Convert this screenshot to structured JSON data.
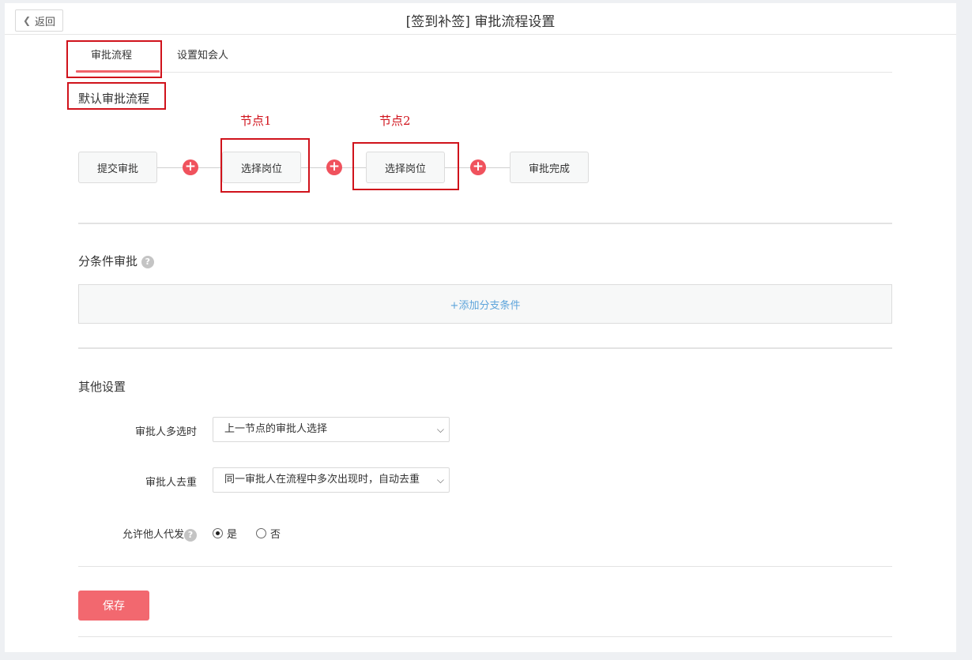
{
  "header": {
    "back_label": "返回",
    "title": "[签到补签] 审批流程设置"
  },
  "tabs": [
    {
      "label": "审批流程",
      "active": true
    },
    {
      "label": "设置知会人",
      "active": false
    }
  ],
  "default_flow": {
    "title": "默认审批流程",
    "nodes": [
      "提交审批",
      "选择岗位",
      "选择岗位",
      "审批完成"
    ],
    "annotations": [
      "节点1",
      "节点2"
    ]
  },
  "conditional": {
    "title": "分条件审批",
    "add_branch_label": "+添加分支条件"
  },
  "other_settings": {
    "title": "其他设置",
    "multi_select": {
      "label": "审批人多选时",
      "value": "上一节点的审批人选择"
    },
    "dedupe": {
      "label": "审批人去重",
      "value": "同一审批人在流程中多次出现时，自动去重"
    },
    "allow_proxy": {
      "label": "允许他人代发",
      "options": [
        {
          "label": "是",
          "checked": true
        },
        {
          "label": "否",
          "checked": false
        }
      ]
    }
  },
  "actions": {
    "save_label": "保存"
  },
  "colors": {
    "accent": "#f0525d",
    "link": "#5da4db",
    "annotation": "#d0121b"
  }
}
